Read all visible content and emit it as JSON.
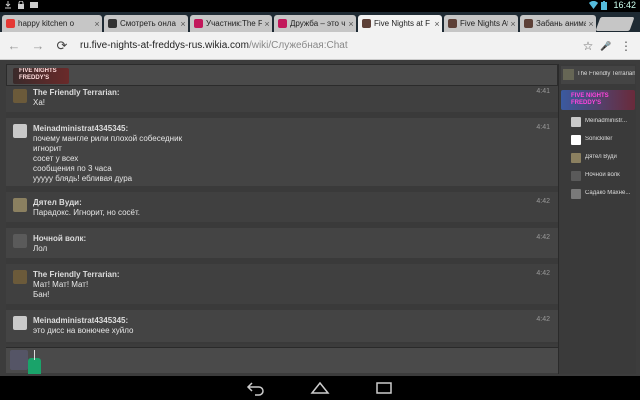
{
  "status_bar": {
    "time": "16:42"
  },
  "tabs": [
    {
      "title": "happy kitchen о",
      "favicon_color": "#e53935",
      "close": "×",
      "active": false
    },
    {
      "title": "Смотреть онла",
      "favicon_color": "#333333",
      "close": "×",
      "active": false
    },
    {
      "title": "Участник:The F",
      "favicon_color": "#c2185b",
      "close": "×",
      "active": false
    },
    {
      "title": "Дружба – это ч",
      "favicon_color": "#c2185b",
      "close": "×",
      "active": false
    },
    {
      "title": "Five Nights at F",
      "favicon_color": "#5d4037",
      "close": "×",
      "active": true
    },
    {
      "title": "Five Nights At F",
      "favicon_color": "#5d4037",
      "close": "×",
      "active": false
    },
    {
      "title": "Забань анима",
      "favicon_color": "#5d4037",
      "close": "×",
      "active": false
    }
  ],
  "address_bar": {
    "url_host": "ru.five-nights-at-freddys-rus.wikia.com",
    "url_path": "/wiki/Служебная:Chat",
    "back_icon": "←",
    "forward_icon": "→",
    "reload_icon": "⟳",
    "star_icon": "☆",
    "mic_icon": "🎤",
    "menu_icon": "⋮"
  },
  "chat": {
    "wiki_logo_line1": "FIVE NIGHTS",
    "wiki_logo_line2": "FREDDY'S",
    "messages": [
      {
        "user": "The Friendly Terrarian:",
        "time": "4:41",
        "lines": [
          "Ха!"
        ],
        "avatar_color": "#6b5a3a"
      },
      {
        "user": "Meinadministrat4345345:",
        "time": "4:41",
        "lines": [
          "почему мангле рили плохой собеседник",
          "игнорит",
          "сосет у всех",
          "сообщения по 3 часа",
          "ууууу блядь! ебливая дура"
        ],
        "avatar_color": "#c9c9c9"
      },
      {
        "user": "Дятел Вуди:",
        "time": "4:42",
        "lines": [
          "Парадокс. Игнорит, но сосёт."
        ],
        "avatar_color": "#8b8060"
      },
      {
        "user": "Ночной волк:",
        "time": "4:42",
        "lines": [
          "Лол"
        ],
        "avatar_color": "#5a5a5a"
      },
      {
        "user": "The Friendly Terrarian:",
        "time": "4:42",
        "lines": [
          "Мат! Мат! Мат!",
          "Бан!"
        ],
        "avatar_color": "#6b5a3a"
      },
      {
        "user": "Meinadministrat4345345:",
        "time": "4:42",
        "lines": [
          "это дисс на вонючее хуйло"
        ],
        "avatar_color": "#c9c9c9"
      }
    ]
  },
  "sidebar": {
    "current_user": "The Friendly Terrarian",
    "banner_line1": "FIVE NIGHTS",
    "banner_line2": "FREDDY'S",
    "users": [
      {
        "name": "Meinadministr...",
        "avatar_color": "#c9c9c9"
      },
      {
        "name": "Sonickiller",
        "avatar_color": "#ffffff"
      },
      {
        "name": "Дятел Вуди",
        "avatar_color": "#8b8060"
      },
      {
        "name": "Ночной волк",
        "avatar_color": "#5a5a5a"
      },
      {
        "name": "Садако Махне...",
        "avatar_color": "#7a7a7a"
      }
    ]
  }
}
